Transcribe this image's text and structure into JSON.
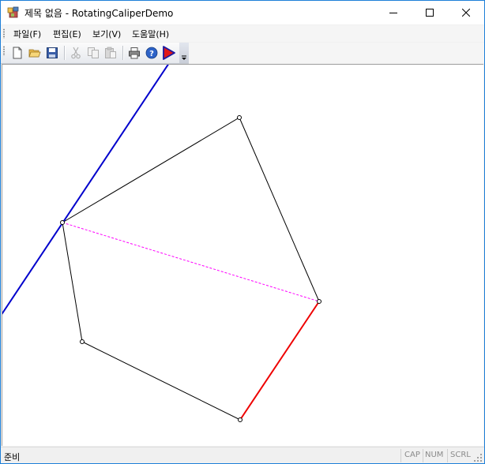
{
  "window": {
    "title": "제목 없음 - RotatingCaliperDemo",
    "colors": {
      "titlebar": "#ffffff",
      "frame": "#1e7fd8"
    }
  },
  "menu": {
    "items": [
      {
        "label": "파일(F)"
      },
      {
        "label": "편집(E)"
      },
      {
        "label": "보기(V)"
      },
      {
        "label": "도움말(H)"
      }
    ]
  },
  "toolbar": {
    "buttons": [
      {
        "icon": "new-document-icon"
      },
      {
        "icon": "open-folder-icon"
      },
      {
        "icon": "save-icon"
      },
      {
        "icon": "cut-icon",
        "disabled": true
      },
      {
        "icon": "copy-icon",
        "disabled": true
      },
      {
        "icon": "paste-icon",
        "disabled": true
      },
      {
        "icon": "print-icon"
      },
      {
        "icon": "help-icon"
      },
      {
        "icon": "play-icon"
      }
    ]
  },
  "canvas": {
    "colors": {
      "polygon": "#000000",
      "caliper": "#0000cc",
      "diameter": "#ff00ff",
      "antipodal_edge": "#ee0000",
      "background": "#ffffff"
    }
  },
  "statusbar": {
    "text": "준비",
    "indicators": {
      "cap": "CAP",
      "num": "NUM",
      "scrl": "SCRL"
    }
  }
}
